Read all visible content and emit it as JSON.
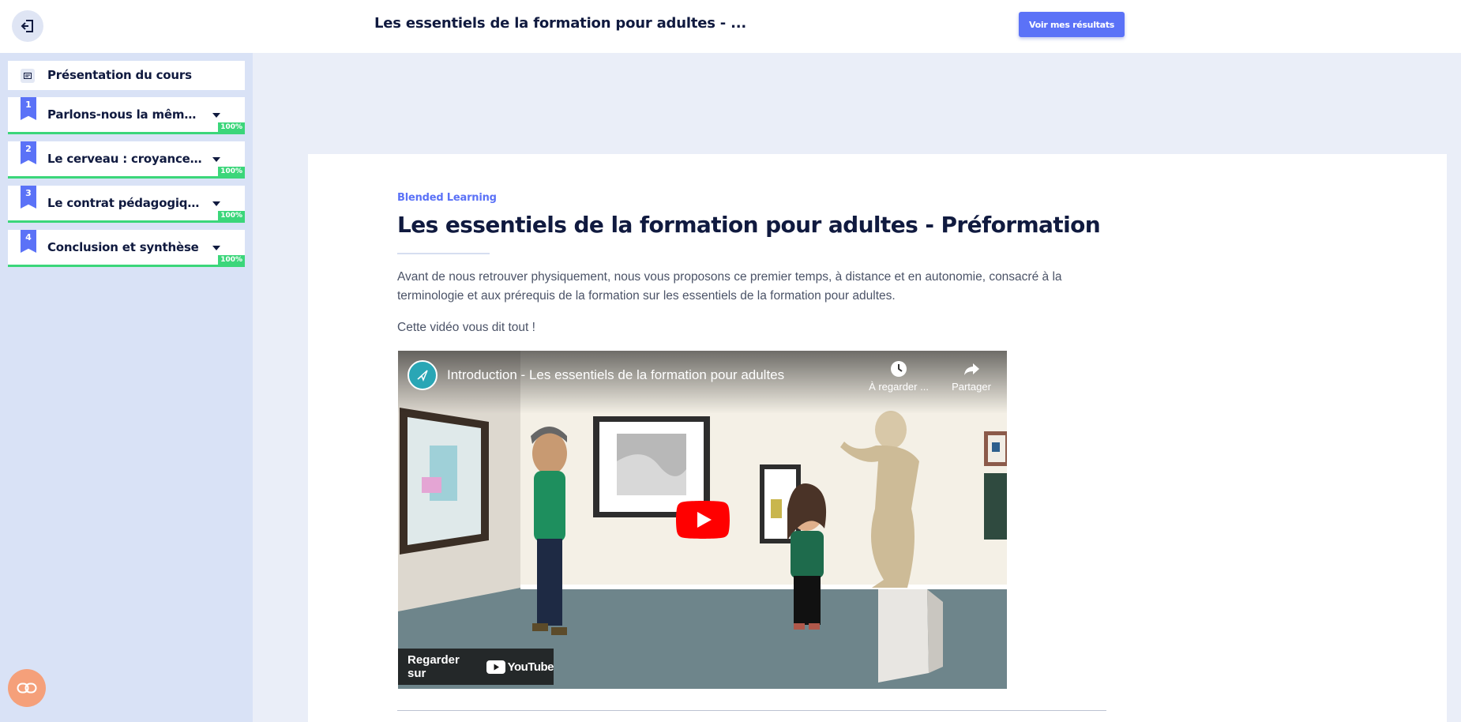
{
  "topbar": {
    "course_title": "Les essentiels de la formation pour adultes - ...",
    "results_button": "Voir mes résultats"
  },
  "sidebar": {
    "overview_label": "Présentation du cours",
    "chapters": [
      {
        "number": "1",
        "label": "Parlons-nous la même l...",
        "progress": "100%"
      },
      {
        "number": "2",
        "label": "Le cerveau : croyances ...",
        "progress": "100%"
      },
      {
        "number": "3",
        "label": "Le contrat pédagogique...",
        "progress": "100%"
      },
      {
        "number": "4",
        "label": "Conclusion et synthèse",
        "progress": "100%"
      }
    ]
  },
  "lesson": {
    "kicker": "Blended Learning",
    "title": "Les essentiels de la formation pour adultes - Préformation",
    "paragraph_1": "Avant de nous retrouver physiquement, nous vous proposons ce premier temps, à distance et en autonomie, consacré à la terminologie et aux prérequis de la formation sur les essentiels de la formation pour adultes.",
    "paragraph_2": "Cette vidéo vous dit tout !"
  },
  "video": {
    "title": "Introduction - Les essentiels de la formation pour adultes",
    "watch_later": "À regarder ...",
    "share": "Partager",
    "watch_on": "Regarder sur",
    "platform": "YouTube"
  },
  "colors": {
    "accent": "#5b72f7",
    "progress": "#3bd67a",
    "text_dark": "#101a3f",
    "sidebar_bg": "#d9e2f6",
    "page_bg": "#eaeef8"
  },
  "icons": {
    "exit": "exit-icon",
    "overview": "list-icon",
    "chevron": "chevron-down-icon",
    "clock": "clock-icon",
    "share": "share-icon",
    "play": "play-icon",
    "help": "link-icon"
  }
}
